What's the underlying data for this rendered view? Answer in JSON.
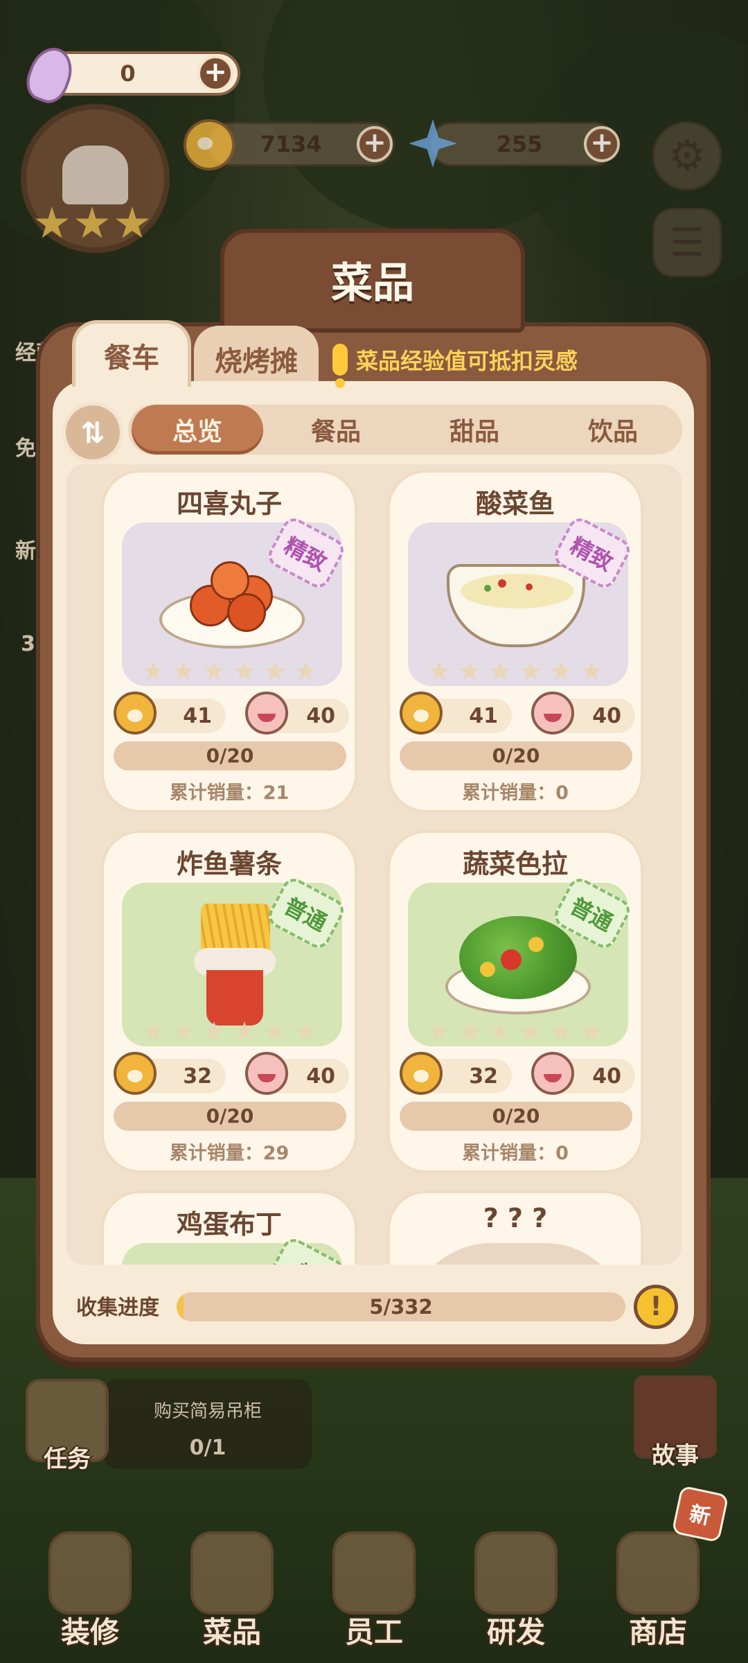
{
  "hud": {
    "inspiration": "0",
    "paw_coins": "7134",
    "gems": "255"
  },
  "scene_labels": {
    "left_top": "经营",
    "left_mid": "免",
    "left_low": "新",
    "left_num": "3"
  },
  "panel": {
    "title": "菜品",
    "tabs": [
      "餐车",
      "烧烤摊"
    ],
    "hint": "菜品经验值可抵扣灵感",
    "sort_icon": "⇅",
    "filters": [
      "总览",
      "餐品",
      "甜品",
      "饮品"
    ],
    "active_filter": "总览"
  },
  "dishes": [
    {
      "name": "四喜丸子",
      "grade": "精致",
      "paw": "41",
      "smile": "40",
      "progress": "0/20",
      "sales": "累计销量：21"
    },
    {
      "name": "酸菜鱼",
      "grade": "精致",
      "paw": "41",
      "smile": "40",
      "progress": "0/20",
      "sales": "累计销量：0"
    },
    {
      "name": "炸鱼薯条",
      "grade": "普通",
      "paw": "32",
      "smile": "40",
      "progress": "0/20",
      "sales": "累计销量：29"
    },
    {
      "name": "蔬菜色拉",
      "grade": "普通",
      "paw": "32",
      "smile": "40",
      "progress": "0/20",
      "sales": "累计销量：0"
    },
    {
      "name": "鸡蛋布丁",
      "grade": "普"
    },
    {
      "name": "? ? ?"
    }
  ],
  "collection": {
    "label": "收集进度",
    "value": "5/332",
    "fraction": 0.015,
    "info_icon": "!"
  },
  "task_popup": {
    "title": "购买简易吊柜",
    "count": "0/1"
  },
  "side_buttons": {
    "task": "任务",
    "story": "故事"
  },
  "bottom_nav": [
    "装修",
    "菜品",
    "员工",
    "研发",
    "商店"
  ],
  "new_badge": "新",
  "colors": {
    "panel_brown": "#8a5a3f",
    "panel_cream": "#f7ead7",
    "hint_yellow": "#ffd25a",
    "grade_fine": "#b052b0",
    "grade_normal": "#4f9a3a"
  }
}
